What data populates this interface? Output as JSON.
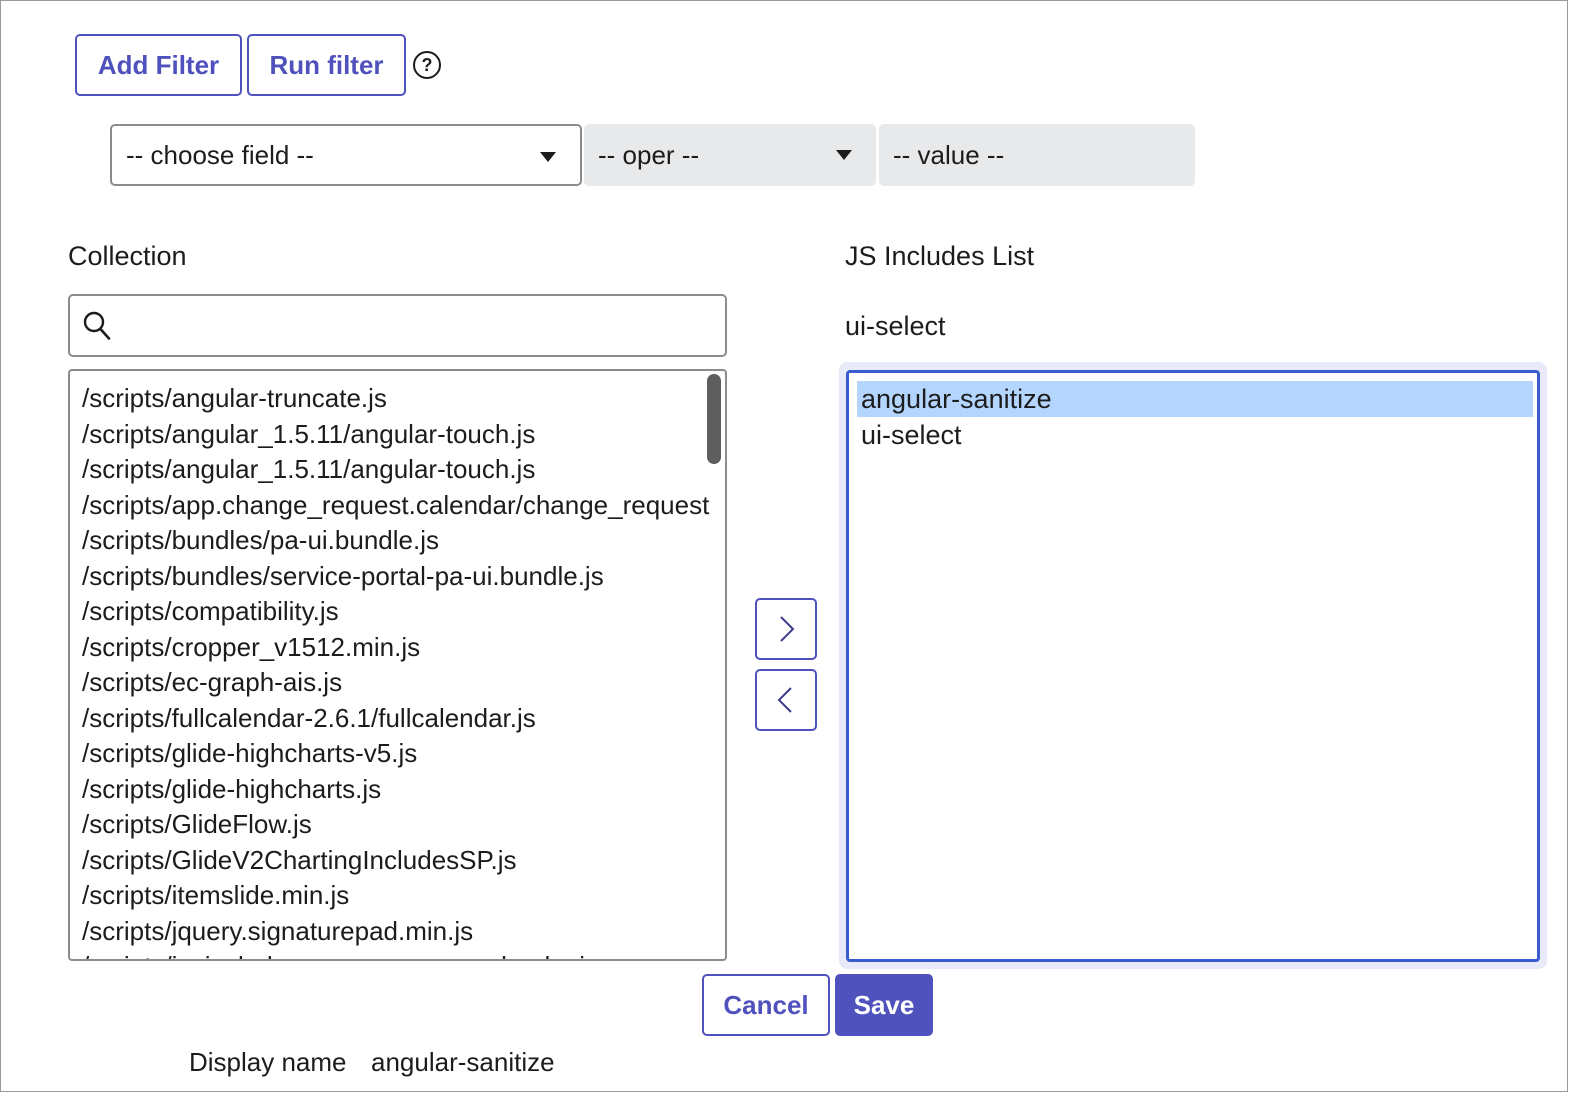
{
  "filter": {
    "add_filter_label": "Add Filter",
    "run_filter_label": "Run filter",
    "help_glyph": "?",
    "field_select": "-- choose field --",
    "oper_select": "-- oper --",
    "value_field": "-- value --"
  },
  "collection": {
    "label": "Collection",
    "search_placeholder": "",
    "items": [
      "/scripts/angular-truncate.js",
      "/scripts/angular_1.5.11/angular-touch.js",
      "/scripts/angular_1.5.11/angular-touch.js",
      "/scripts/app.change_request.calendar/change_request",
      "/scripts/bundles/pa-ui.bundle.js",
      "/scripts/bundles/service-portal-pa-ui.bundle.js",
      "/scripts/compatibility.js",
      "/scripts/cropper_v1512.min.js",
      "/scripts/ec-graph-ais.js",
      "/scripts/fullcalendar-2.6.1/fullcalendar.js",
      "/scripts/glide-highcharts-v5.js",
      "/scripts/glide-highcharts.js",
      "/scripts/GlideFlow.js",
      "/scripts/GlideV2ChartingIncludesSP.js",
      "/scripts/itemslide.min.js",
      "/scripts/jquery.signaturepad.min.js",
      "/scripts/jspinclude.sepresponsepageloader.js"
    ]
  },
  "includes": {
    "label": "JS Includes List",
    "current_value": "ui-select",
    "items": [
      "angular-sanitize",
      "ui-select"
    ],
    "selected_index": 0
  },
  "actions": {
    "cancel_label": "Cancel",
    "save_label": "Save"
  },
  "display": {
    "label": "Display name",
    "value": "angular-sanitize"
  },
  "icons": {
    "help": "help-circle-icon",
    "search": "search-icon",
    "move_right": "chevron-right-icon",
    "move_left": "chevron-left-icon",
    "dropdown": "caret-down-icon"
  },
  "colors": {
    "accent": "#4f52bd",
    "selection": "#b4d5fe",
    "focus_border": "#3b5ccc"
  }
}
